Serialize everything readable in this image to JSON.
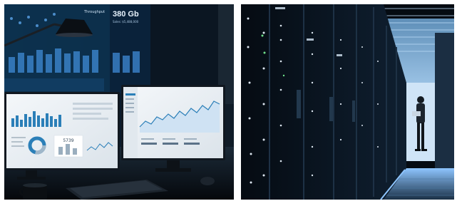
{
  "left_photo": {
    "background_monitor": {
      "header_label": "Throughput",
      "big_value": "380 Gb",
      "sub_value": "Sales: $5,488,000"
    },
    "left_monitor": {
      "card_value": "5739"
    },
    "colors": {
      "dark_bg": "#07121d",
      "accent_blue": "#3f8bd6",
      "screen_white": "#eef2f5"
    }
  },
  "right_photo": {
    "colors": {
      "rack_dark": "#0a1522",
      "led_white": "#dce6f0",
      "floor_glow": "#8ec5ff"
    }
  }
}
